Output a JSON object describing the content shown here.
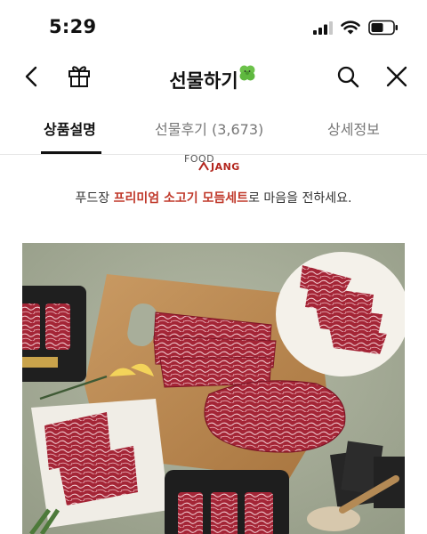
{
  "status_bar": {
    "time": "5:29"
  },
  "header": {
    "title": "선물하기"
  },
  "tabs": [
    {
      "label": "상품설명",
      "active": true
    },
    {
      "label": "선물후기 (3,673)",
      "active": false
    },
    {
      "label": "상세정보",
      "active": false
    }
  ],
  "brand": {
    "logo_top": "FOOD",
    "logo_bottom": "JANG"
  },
  "tagline": {
    "prefix": "푸드장 ",
    "highlight": "프리미엄 소고기 모듬세트",
    "suffix": "로 마음을 전하세요."
  },
  "product_image": {
    "alt_icon": "beef-gift-set-photo"
  },
  "colors": {
    "accent": "#c0392b",
    "text": "#111111",
    "muted": "#777777"
  }
}
